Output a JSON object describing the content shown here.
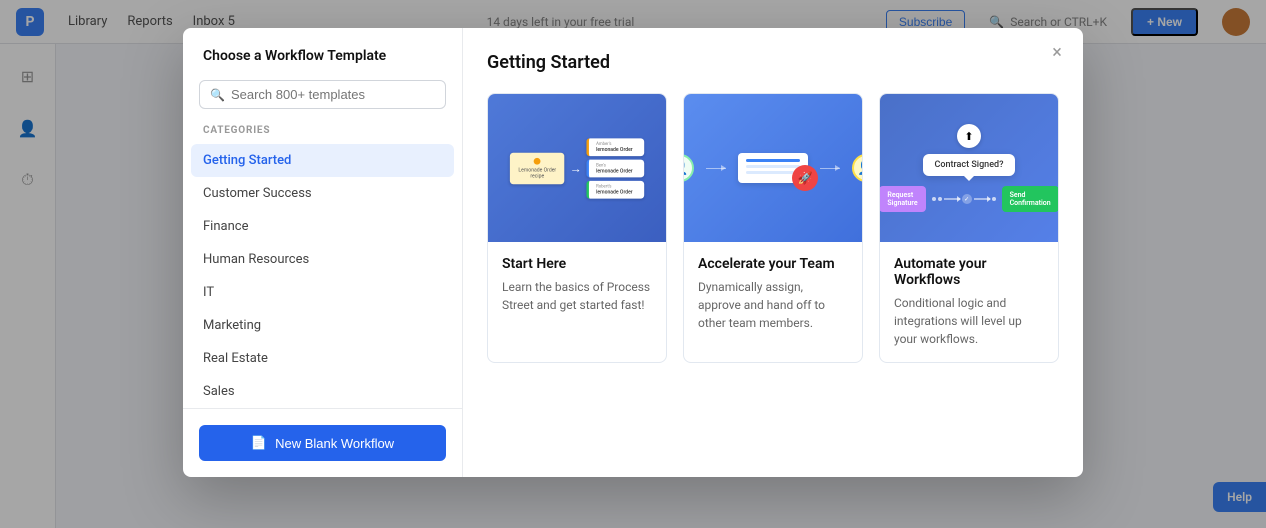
{
  "app": {
    "logo": "P",
    "nav": {
      "links": [
        "Library",
        "Reports",
        "Inbox 5"
      ],
      "trial_text": "14 days left in your free trial",
      "subscribe_label": "Subscribe",
      "search_placeholder": "Search or CTRL+K",
      "new_label": "+ New"
    }
  },
  "modal": {
    "title": "Choose a Workflow Template",
    "search_placeholder": "Search 800+ templates",
    "categories_label": "CATEGORIES",
    "categories": [
      {
        "id": "getting-started",
        "label": "Getting Started",
        "active": true
      },
      {
        "id": "customer-success",
        "label": "Customer Success",
        "active": false
      },
      {
        "id": "finance",
        "label": "Finance",
        "active": false
      },
      {
        "id": "human-resources",
        "label": "Human Resources",
        "active": false
      },
      {
        "id": "it",
        "label": "IT",
        "active": false
      },
      {
        "id": "marketing",
        "label": "Marketing",
        "active": false
      },
      {
        "id": "real-estate",
        "label": "Real Estate",
        "active": false
      },
      {
        "id": "sales",
        "label": "Sales",
        "active": false
      }
    ],
    "new_blank_label": "New Blank Workflow",
    "content_title": "Getting Started",
    "cards": [
      {
        "id": "start-here",
        "title": "Start Here",
        "description": "Learn the basics of Process Street and get started fast!"
      },
      {
        "id": "accelerate-team",
        "title": "Accelerate your Team",
        "description": "Dynamically assign, approve and hand off to other team members."
      },
      {
        "id": "automate-workflows",
        "title": "Automate your Workflows",
        "description": "Conditional logic and integrations will level up your workflows."
      }
    ]
  },
  "help_label": "Help",
  "icons": {
    "search": "🔍",
    "close": "×",
    "document": "📄",
    "new_blank": "📄"
  }
}
